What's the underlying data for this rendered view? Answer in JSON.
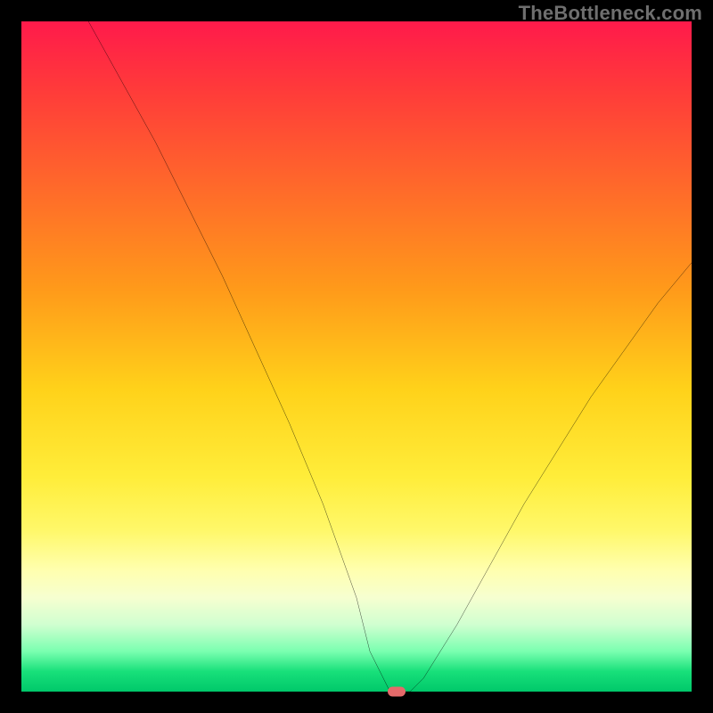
{
  "watermark": "TheBottleneck.com",
  "colors": {
    "frame_bg": "#000000",
    "watermark": "#6f6f6f",
    "curve": "#000000",
    "marker": "#e46a6a",
    "gradient_stops": [
      "#ff1a4b",
      "#ff3a3a",
      "#ff6a2a",
      "#ff9a1a",
      "#ffd21a",
      "#ffed3a",
      "#fff86a",
      "#ffffb0",
      "#f6ffd0",
      "#d0ffd0",
      "#7affb0",
      "#18e07a",
      "#00c86a"
    ]
  },
  "chart_data": {
    "type": "line",
    "title": "",
    "xlabel": "",
    "ylabel": "",
    "xlim": [
      0,
      100
    ],
    "ylim": [
      0,
      100
    ],
    "grid": false,
    "legend": false,
    "series": [
      {
        "name": "bottleneck-curve",
        "x": [
          10,
          15,
          20,
          25,
          30,
          35,
          40,
          45,
          50,
          52,
          55,
          58,
          60,
          65,
          70,
          75,
          80,
          85,
          90,
          95,
          100
        ],
        "y": [
          100,
          91,
          82,
          72,
          62,
          51,
          40,
          28,
          14,
          6,
          0,
          0,
          2,
          10,
          19,
          28,
          36,
          44,
          51,
          58,
          64
        ]
      }
    ],
    "marker": {
      "x": 56,
      "y": 0
    },
    "background_metric": "bottleneck_severity_gradient"
  }
}
